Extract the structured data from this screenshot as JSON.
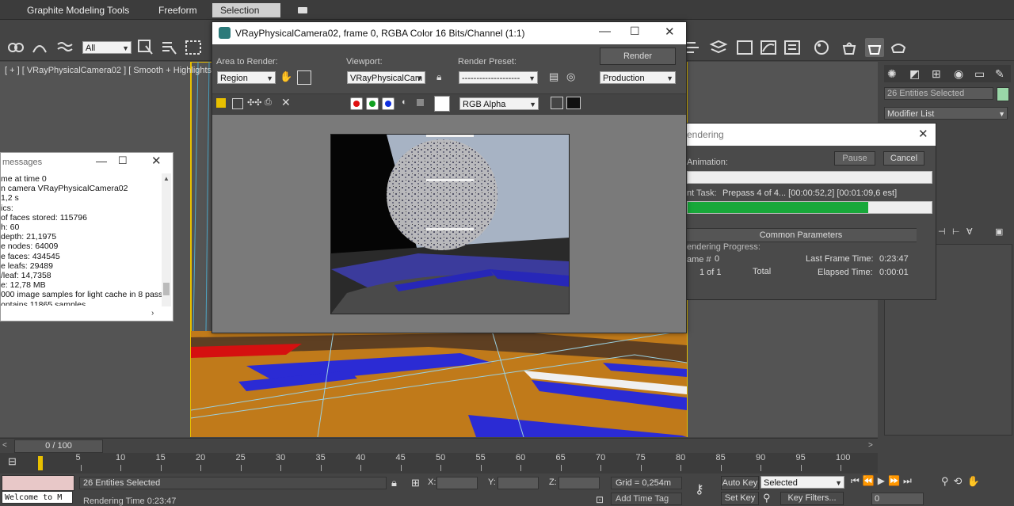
{
  "ribbon": {
    "tabs": [
      {
        "label": "Graphite Modeling Tools",
        "active": false
      },
      {
        "label": "Freeform",
        "active": false
      },
      {
        "label": "Selection",
        "active": true
      }
    ]
  },
  "toolbar": {
    "filter_select": "All",
    "layer_icon": "layers-icon"
  },
  "viewport": {
    "label": "[ + ] [ VRayPhysicalCamera02 ] [ Smooth + Highlights ]"
  },
  "frame_buffer": {
    "title": "VRayPhysicalCamera02, frame 0, RGBA Color 16 Bits/Channel (1:1)",
    "area_to_render_label": "Area to Render:",
    "area_to_render_value": "Region",
    "viewport_label": "Viewport:",
    "viewport_value": "VRayPhysicalCam",
    "render_preset_label": "Render Preset:",
    "render_preset_value": "--------------------",
    "render_button": "Render",
    "production_value": "Production",
    "channel_value": "RGB Alpha",
    "colors": {
      "red": "#e01010",
      "green": "#10a020",
      "blue": "#1030e0"
    }
  },
  "messages": {
    "title": "messages",
    "lines": [
      "me at time 0",
      "n camera VRayPhysicalCamera02",
      "1,2 s",
      "ics:",
      "of faces stored: 115796",
      "h: 60",
      "depth: 21,1975",
      "e nodes: 64009",
      "e faces: 434545",
      "e leafs: 29489",
      "/leaf: 14,7358",
      "e: 12,78 MB",
      "000 image samples for light cache in 8 passes.",
      "ontains 11865 samples."
    ]
  },
  "render_dialog": {
    "title": "endering",
    "animation_label": "Animation:",
    "pause_button": "Pause",
    "cancel_button": "Cancel",
    "task_label": "nt Task:",
    "task_value": "Prepass 4 of 4... [00:00:52,2] [00:01:09,6 est]",
    "task_progress": 0.74,
    "common_params": "Common Parameters",
    "rendering_progress": "endering Progress:",
    "frame_label": "ame #",
    "frame_value": "0",
    "of_value": "1 of 1",
    "total_label": "Total",
    "last_frame_label": "Last Frame Time:",
    "last_frame_value": "0:23:47",
    "elapsed_label": "Elapsed Time:",
    "elapsed_value": "0:00:01"
  },
  "command_panel": {
    "selection_field": "26 Entities Selected",
    "modifier_list": "Modifier List",
    "swatch_color": "#9ad7a8"
  },
  "timeline": {
    "slider_label": "0 / 100",
    "ticks": [
      "5",
      "10",
      "15",
      "20",
      "25",
      "30",
      "35",
      "40",
      "45",
      "50",
      "55",
      "60",
      "65",
      "70",
      "75",
      "80",
      "85",
      "90",
      "95",
      "100"
    ]
  },
  "statusbar": {
    "maxscript": "Welcome to M",
    "entities": "26 Entities Selected",
    "rendering_time": "Rendering Time  0:23:47",
    "x_label": "X:",
    "y_label": "Y:",
    "z_label": "Z:",
    "grid": "Grid = 0,254m",
    "auto_key": "Auto Key",
    "selected": "Selected",
    "set_key": "Set Key",
    "key_filters": "Key Filters...",
    "add_time_tag": "Add Time Tag",
    "frame_field": "0"
  }
}
